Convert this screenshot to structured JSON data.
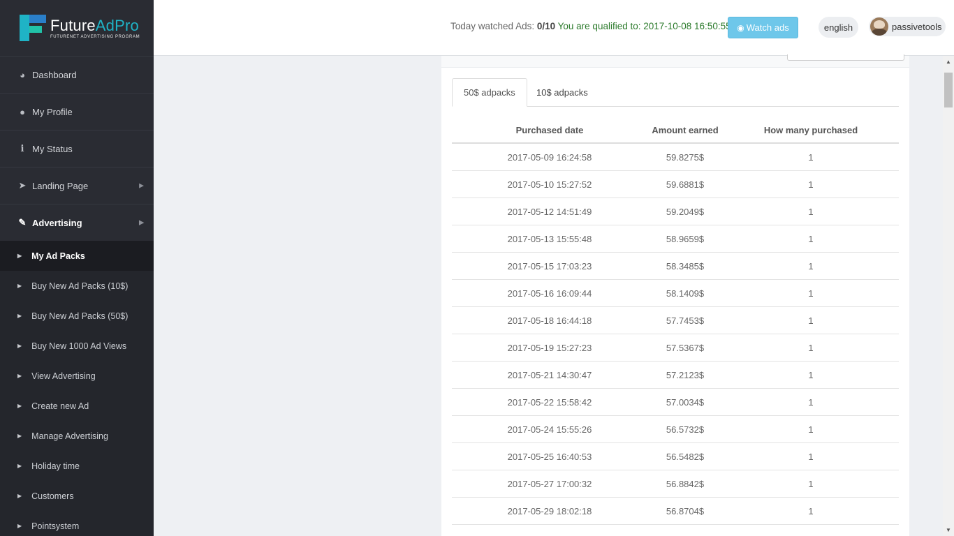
{
  "brand": {
    "name_main": "Future",
    "name_accent": "AdPro",
    "tagline": "FUTURENET ADVERTISING PROGRAM"
  },
  "sidebar": {
    "items": [
      {
        "label": "Dashboard",
        "icon": "dashboard-icon"
      },
      {
        "label": "My Profile",
        "icon": "user-icon"
      },
      {
        "label": "My Status",
        "icon": "info-icon"
      },
      {
        "label": "Landing Page",
        "icon": "paper-plane-icon"
      },
      {
        "label": "Advertising",
        "icon": "magic-wand-icon"
      }
    ],
    "subitems": [
      {
        "label": "My Ad Packs"
      },
      {
        "label": "Buy New Ad Packs (10$)"
      },
      {
        "label": "Buy New Ad Packs (50$)"
      },
      {
        "label": "Buy New 1000 Ad Views"
      },
      {
        "label": "View Advertising"
      },
      {
        "label": "Create new Ad"
      },
      {
        "label": "Manage Advertising"
      },
      {
        "label": "Holiday time"
      },
      {
        "label": "Customers"
      },
      {
        "label": "Pointsystem"
      }
    ]
  },
  "header": {
    "watched_label": "Today watched Ads:",
    "watched_count": "0/10",
    "qualified_text": "You are qualified to: 2017-10-08 16:50:55",
    "watch_button": "Watch ads",
    "language": "english",
    "username": "passivetools"
  },
  "tabs": [
    {
      "label": "50$ adpacks"
    },
    {
      "label": "10$ adpacks"
    }
  ],
  "table": {
    "columns": [
      "Purchased date",
      "Amount earned",
      "How many purchased"
    ],
    "rows": [
      [
        "2017-05-09 16:24:58",
        "59.8275$",
        "1"
      ],
      [
        "2017-05-10 15:27:52",
        "59.6881$",
        "1"
      ],
      [
        "2017-05-12 14:51:49",
        "59.2049$",
        "1"
      ],
      [
        "2017-05-13 15:55:48",
        "58.9659$",
        "1"
      ],
      [
        "2017-05-15 17:03:23",
        "58.3485$",
        "1"
      ],
      [
        "2017-05-16 16:09:44",
        "58.1409$",
        "1"
      ],
      [
        "2017-05-18 16:44:18",
        "57.7453$",
        "1"
      ],
      [
        "2017-05-19 15:27:23",
        "57.5367$",
        "1"
      ],
      [
        "2017-05-21 14:30:47",
        "57.2123$",
        "1"
      ],
      [
        "2017-05-22 15:58:42",
        "57.0034$",
        "1"
      ],
      [
        "2017-05-24 15:55:26",
        "56.5732$",
        "1"
      ],
      [
        "2017-05-25 16:40:53",
        "56.5482$",
        "1"
      ],
      [
        "2017-05-27 17:00:32",
        "56.8842$",
        "1"
      ],
      [
        "2017-05-29 18:02:18",
        "56.8704$",
        "1"
      ]
    ]
  }
}
